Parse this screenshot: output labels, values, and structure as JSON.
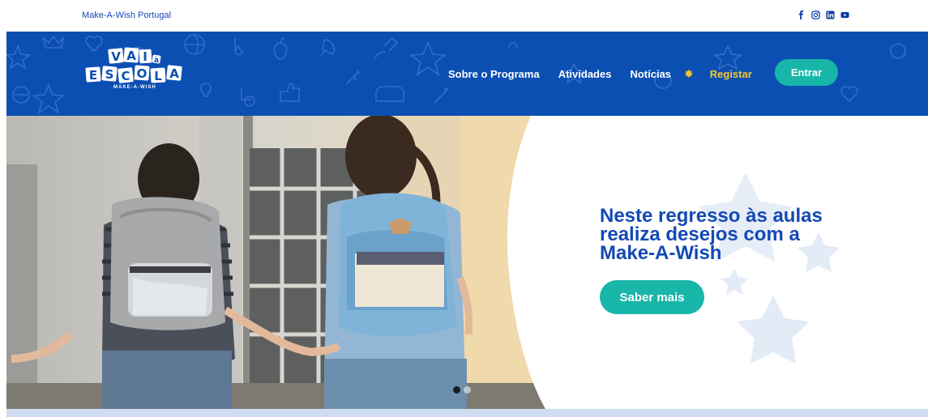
{
  "topbar": {
    "brand_link": "Make-A-Wish Portugal",
    "socials": [
      "facebook-icon",
      "instagram-icon",
      "linkedin-icon",
      "youtube-icon"
    ]
  },
  "logo": {
    "line1": "VAI",
    "small": "à",
    "line2": "ESCOLA",
    "sub": "MAKE-A-WISH"
  },
  "nav": {
    "items": [
      "Sobre o Programa",
      "Atividades",
      "Notícias"
    ],
    "star_icon": "star-icon",
    "register": "Registar",
    "login": "Entrar"
  },
  "hero": {
    "title": "Neste regresso às aulas realiza desejos com a Make-A-Wish",
    "cta": "Saber mais",
    "slides": 2,
    "active_slide": 1
  },
  "colors": {
    "brand_blue": "#0b4fb3",
    "title_blue": "#1449b5",
    "teal": "#18b6a9",
    "yellow": "#f7c62f",
    "light_band": "#cfdcf2"
  }
}
